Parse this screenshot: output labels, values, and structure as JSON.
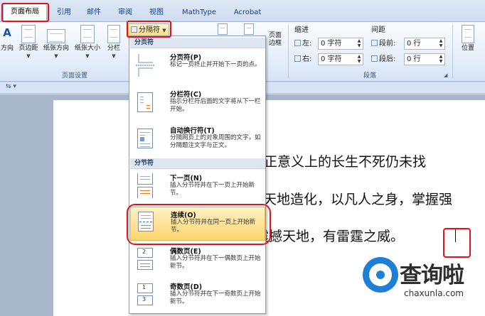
{
  "tabs": {
    "page_layout": "页面布局",
    "references": "引用",
    "mailings": "邮件",
    "review": "审阅",
    "view": "视图",
    "mathtype": "MathType",
    "acrobat": "Acrobat"
  },
  "ribbon": {
    "text_direction": "方向",
    "margins": "页边距",
    "orientation": "纸张方向",
    "size": "纸张大小",
    "columns": "分栏",
    "breaks": "分隔符",
    "page_border": "页面\n边框",
    "page_setup_group": "页面设置",
    "indent_label": "缩进",
    "spacing_label": "间距",
    "indent_left_label": "左:",
    "indent_left_value": "0 字符",
    "indent_right_label": "右:",
    "indent_right_value": "0 字符",
    "spacing_before_label": "段前:",
    "spacing_before_value": "0 行",
    "spacing_after_label": "段后:",
    "spacing_after_value": "0 行",
    "paragraph_group": "段落",
    "position": "位置"
  },
  "menu": {
    "page_breaks_header": "分页符",
    "section_breaks_header": "分节符",
    "items": [
      {
        "title": "分页符(P)",
        "desc": "标记一页终止并开始下一页的点。"
      },
      {
        "title": "分栏符(C)",
        "desc": "指示分栏符后面的文字将从下一栏开始。"
      },
      {
        "title": "自动换行符(T)",
        "desc": "分隔网页上的对象周围的文字，如分隔题注文字与正文。"
      },
      {
        "title": "下一页(N)",
        "desc": "插入分节符并在下一页上开始新节。"
      },
      {
        "title": "连续(O)",
        "desc": "插入分节符并在同一页上开始新节。"
      },
      {
        "title": "偶数页(E)",
        "desc": "插入分节符并在下一偶数页上开始新节。"
      },
      {
        "title": "奇数页(D)",
        "desc": "插入分节符并在下一奇数页上开始新节。"
      }
    ]
  },
  "document": {
    "line1": "然真正意义上的长生不死仍未找",
    "line2": "天地造化，以凡人之身，掌握强",
    "line3": "可震撼天地，有雷霆之威。"
  },
  "watermark": {
    "brand": "查询啦",
    "url": "chaxunla.com"
  },
  "colors": {
    "highlight": "#e0141e",
    "menu_hover": "#ffd56e",
    "ribbon_blue": "#15428b"
  }
}
